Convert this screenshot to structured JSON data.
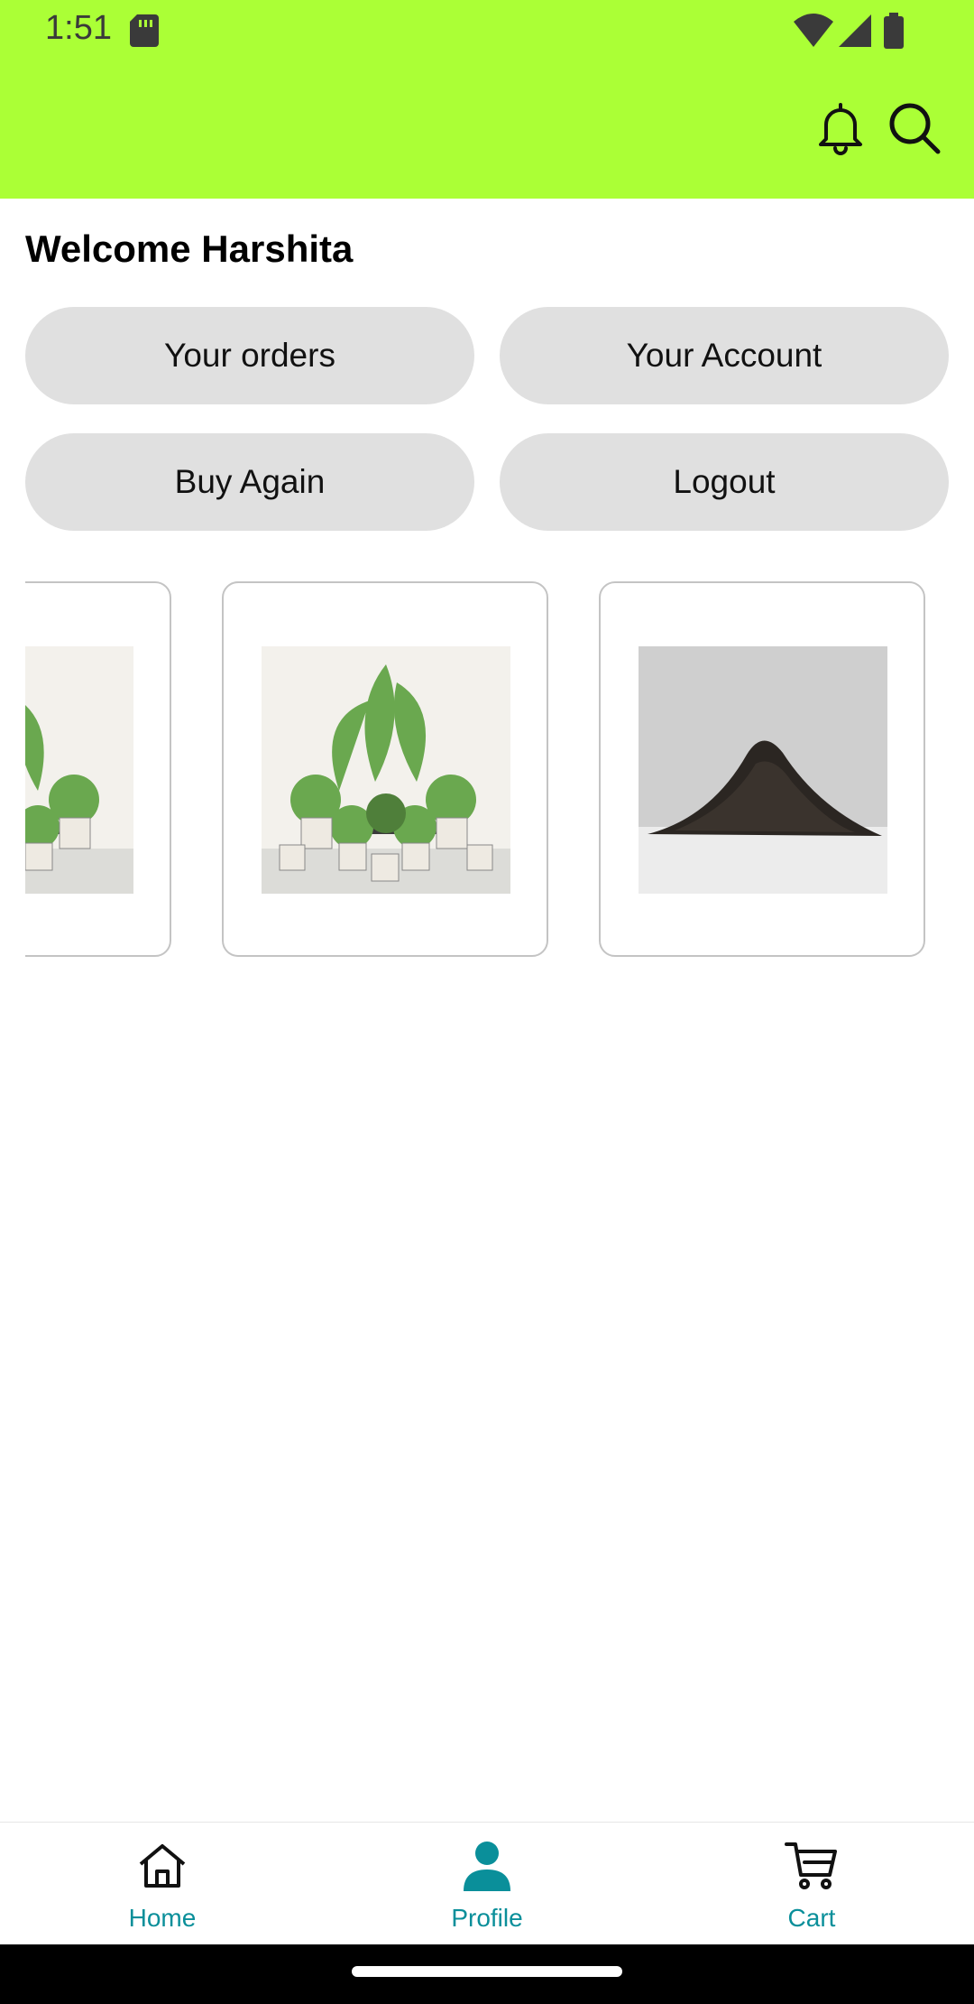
{
  "status_bar": {
    "time": "1:51"
  },
  "header": {
    "background": "#abff36",
    "icons": [
      "bell-icon",
      "search-icon"
    ]
  },
  "welcome": {
    "text": "Welcome Harshita"
  },
  "actions": {
    "orders": "Your orders",
    "account": "Your Account",
    "buy_again": "Buy Again",
    "logout": "Logout"
  },
  "carousel": {
    "items": [
      {
        "image": "potted-plants-collection"
      },
      {
        "image": "potted-plants-collection"
      },
      {
        "image": "soil-mound"
      }
    ]
  },
  "bottom_nav": {
    "accent": "#0a8f9a",
    "items": [
      {
        "label": "Home",
        "icon": "home-icon"
      },
      {
        "label": "Profile",
        "icon": "profile-icon",
        "active": true
      },
      {
        "label": "Cart",
        "icon": "cart-icon"
      }
    ]
  }
}
